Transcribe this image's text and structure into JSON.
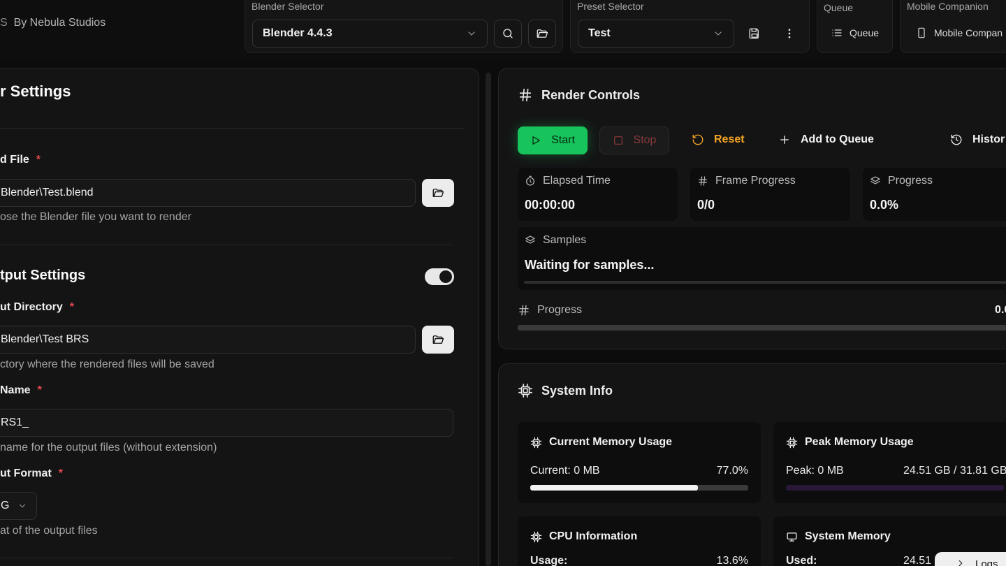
{
  "header": {
    "brand": "By Nebula Studios",
    "blender_selector": {
      "label": "Blender Selector",
      "value": "Blender 4.4.3"
    },
    "preset_selector": {
      "label": "Preset Selector",
      "value": "Test"
    },
    "queue": {
      "label": "Queue",
      "button": "Queue"
    },
    "mobile": {
      "label": "Mobile Companion",
      "button": "Mobile Compan"
    }
  },
  "settings": {
    "title": "r Settings",
    "blend_file": {
      "label": "d File",
      "value": "Blender\\Test.blend",
      "help": "ose the Blender file you want to render"
    },
    "output_section": {
      "title": "tput Settings",
      "toggle_on": true
    },
    "output_directory": {
      "label": "ut Directory",
      "value": "Blender\\Test BRS",
      "help": "ctory where the rendered files will be saved"
    },
    "file_name": {
      "label": "Name",
      "value": "RS1_",
      "help": "name for the output files (without extension)"
    },
    "output_format": {
      "label": "ut Format",
      "value": "G",
      "help": "at of the output files"
    }
  },
  "render_controls": {
    "title": "Render Controls",
    "buttons": {
      "start": "Start",
      "stop": "Stop",
      "reset": "Reset",
      "add_queue": "Add to Queue",
      "history": "Histor"
    },
    "elapsed": {
      "label": "Elapsed Time",
      "value": "00:00:00"
    },
    "frame_progress": {
      "label": "Frame Progress",
      "value": "0/0"
    },
    "progress": {
      "label": "Progress",
      "value": "0.0%"
    },
    "samples": {
      "label": "Samples",
      "status": "Waiting for samples..."
    },
    "overall_progress": {
      "label": "Progress",
      "value": "0.0"
    }
  },
  "system_info": {
    "title": "System Info",
    "current_memory": {
      "title": "Current Memory Usage",
      "current": "Current: 0 MB",
      "percent": "77.0%",
      "fill": 0.77
    },
    "peak_memory": {
      "title": "Peak Memory Usage",
      "peak": "Peak: 0 MB",
      "total": "24.51 GB / 31.81 GB",
      "fill": 0.0
    },
    "cpu": {
      "title": "CPU Information",
      "usage_label": "Usage:",
      "usage": "13.6%"
    },
    "system_memory": {
      "title": "System Memory",
      "used_label": "Used:",
      "used": "24.51"
    },
    "logs_button": "Logs"
  },
  "colors": {
    "accent_green": "#17c45c",
    "reset_orange": "#f5a524",
    "required_red": "#e5484d"
  }
}
